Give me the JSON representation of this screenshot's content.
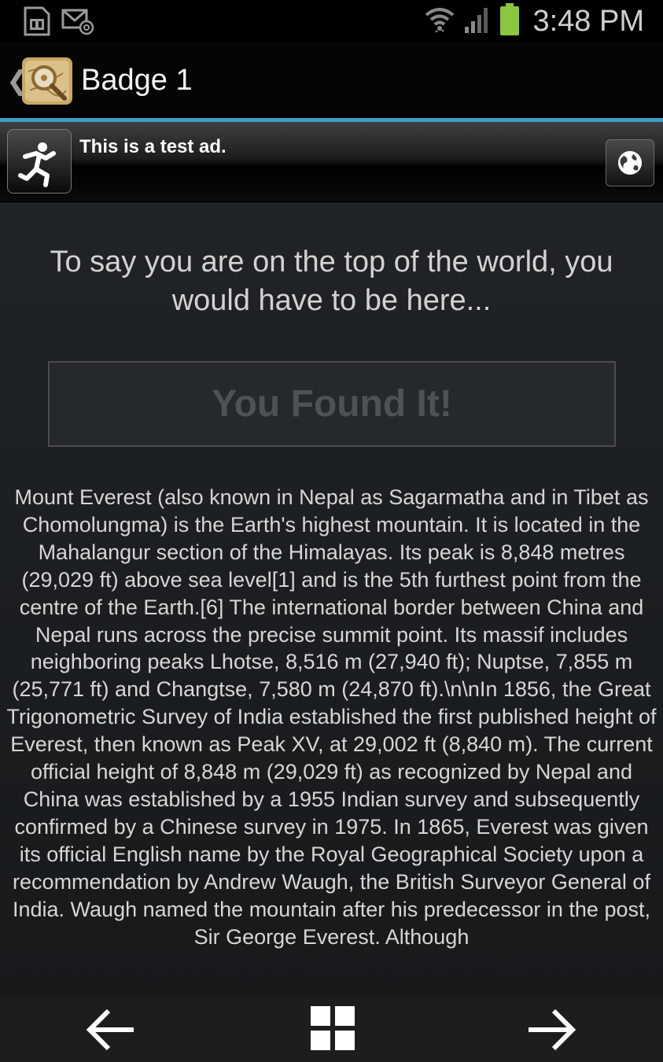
{
  "status_bar": {
    "time": "3:48 PM",
    "icons": [
      "sim-card-icon",
      "email-notification-icon",
      "wifi-icon",
      "signal-icon",
      "battery-icon"
    ]
  },
  "action_bar": {
    "title": "Badge 1",
    "app_icon": "map-magnifier-icon"
  },
  "ad": {
    "text": "This is a test ad.",
    "icon": "running-person-icon",
    "action_icon": "globe-icon"
  },
  "content": {
    "clue": "To say you are on the top of the world, you would have to be here...",
    "found_button": "You Found It!",
    "description": "Mount Everest (also known in Nepal as Sagarmatha and in Tibet as Chomolungma) is the Earth's highest mountain. It is located in the Mahalangur section of the Himalayas. Its peak is 8,848 metres (29,029 ft) above sea level[1] and is the 5th furthest point from the centre of the Earth.[6] The international border between China and Nepal runs across the precise summit point. Its massif includes neighboring peaks Lhotse, 8,516 m (27,940 ft); Nuptse, 7,855 m (25,771 ft) and Changtse, 7,580 m (24,870 ft).\\n\\nIn 1856, the Great Trigonometric Survey of India established the first published height of Everest, then known as Peak XV, at 29,002 ft (8,840 m). The current official height of 8,848 m (29,029 ft) as recognized by Nepal and China was established by a 1955 Indian survey and subsequently confirmed by a Chinese survey in 1975. In 1865, Everest was given its official English name by the Royal Geographical Society upon a recommendation by Andrew Waugh, the British Surveyor General of India. Waugh named the mountain after his predecessor in the post, Sir George Everest. Although"
  },
  "bottom_nav": {
    "prev_icon": "arrow-left-icon",
    "grid_icon": "grid-icon",
    "next_icon": "arrow-right-icon"
  },
  "colors": {
    "accent": "#3a9fc8",
    "battery": "#8cc63f"
  }
}
